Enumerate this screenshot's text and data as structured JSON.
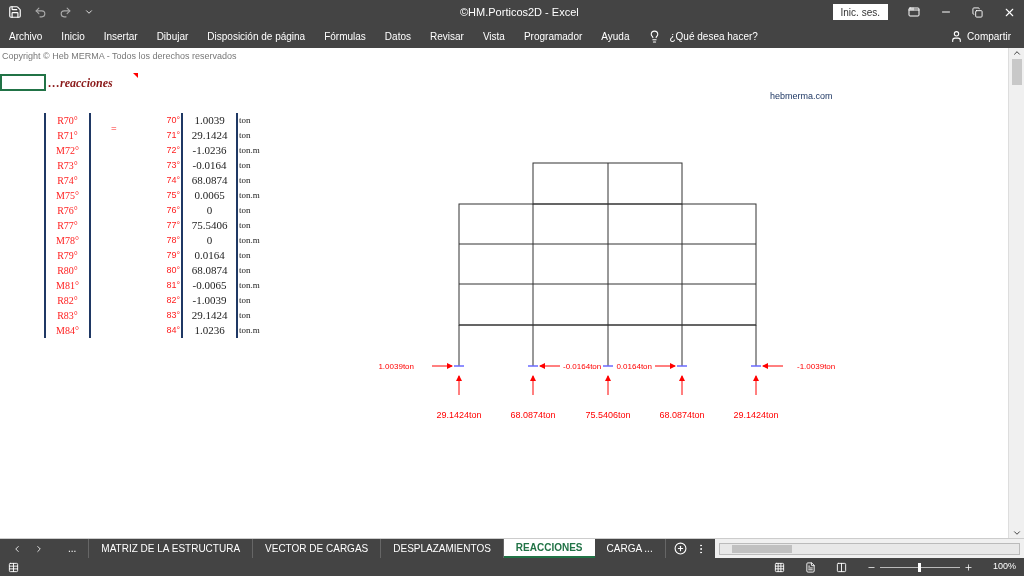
{
  "window": {
    "title": "©HM.Porticos2D  -  Excel",
    "sign_in": "Inic. ses."
  },
  "ribbon": {
    "tabs": [
      "Archivo",
      "Inicio",
      "Insertar",
      "Dibujar",
      "Disposición de página",
      "Fórmulas",
      "Datos",
      "Revisar",
      "Vista",
      "Programador",
      "Ayuda"
    ],
    "tell_me": "¿Qué desea hacer?",
    "share": "Compartir"
  },
  "sheet": {
    "copyright": "Copyright © Heb MERMA - Todos los derechos reservados",
    "heading": "…reacciones",
    "website": "hebmerma.com",
    "equals": "=",
    "rows": [
      {
        "label": "R70°",
        "index": "70°",
        "value": "1.0039",
        "unit": "ton"
      },
      {
        "label": "R71°",
        "index": "71°",
        "value": "29.1424",
        "unit": "ton"
      },
      {
        "label": "M72°",
        "index": "72°",
        "value": "-1.0236",
        "unit": "ton.m"
      },
      {
        "label": "R73°",
        "index": "73°",
        "value": "-0.0164",
        "unit": "ton"
      },
      {
        "label": "R74°",
        "index": "74°",
        "value": "68.0874",
        "unit": "ton"
      },
      {
        "label": "M75°",
        "index": "75°",
        "value": "0.0065",
        "unit": "ton.m"
      },
      {
        "label": "R76°",
        "index": "76°",
        "value": "0",
        "unit": "ton"
      },
      {
        "label": "R77°",
        "index": "77°",
        "value": "75.5406",
        "unit": "ton"
      },
      {
        "label": "M78°",
        "index": "78°",
        "value": "0",
        "unit": "ton.m"
      },
      {
        "label": "R79°",
        "index": "79°",
        "value": "0.0164",
        "unit": "ton"
      },
      {
        "label": "R80°",
        "index": "80°",
        "value": "68.0874",
        "unit": "ton"
      },
      {
        "label": "M81°",
        "index": "81°",
        "value": "-0.0065",
        "unit": "ton.m"
      },
      {
        "label": "R82°",
        "index": "82°",
        "value": "-1.0039",
        "unit": "ton"
      },
      {
        "label": "R83°",
        "index": "83°",
        "value": "29.1424",
        "unit": "ton"
      },
      {
        "label": "M84°",
        "index": "84°",
        "value": "1.0236",
        "unit": "ton.m"
      }
    ],
    "supports": [
      {
        "horizontal": "1.0039ton",
        "kind": "rightward",
        "vertical": "29.1424ton"
      },
      {
        "horizontal": "-0.0164ton",
        "kind": "leftward",
        "vertical": "68.0874ton"
      },
      {
        "kind": "vertical",
        "vertical": "75.5406ton"
      },
      {
        "horizontal": "0.0164ton",
        "kind": "rightward",
        "vertical": "68.0874ton"
      },
      {
        "horizontal": "-1.0039ton",
        "kind": "leftward",
        "vertical": "29.1424ton"
      }
    ]
  },
  "sheet_tabs": [
    {
      "label": "...",
      "selected": false
    },
    {
      "label": "MATRIZ DE LA ESTRUCTURA",
      "selected": false
    },
    {
      "label": "VECTOR DE CARGAS",
      "selected": false
    },
    {
      "label": "DESPLAZAMIENTOS",
      "selected": false
    },
    {
      "label": "REACCIONES",
      "selected": true
    },
    {
      "label": "CARGA ...",
      "selected": false
    }
  ],
  "status_bar": {
    "zoom": "100%",
    "zoom_slider": {
      "level": 0.5
    }
  }
}
